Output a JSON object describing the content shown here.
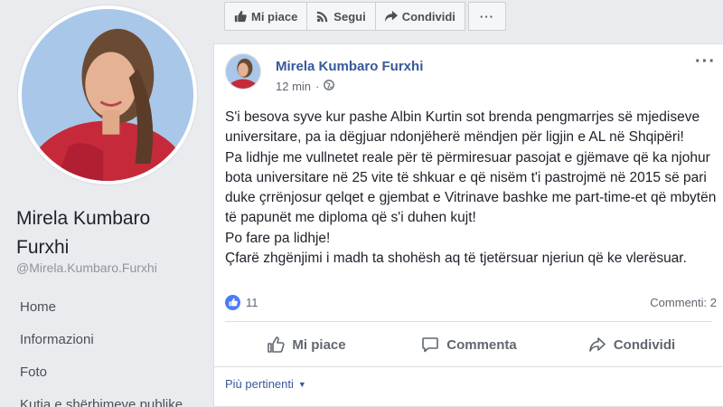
{
  "sidebar": {
    "name": "Mirela Kumbaro Furxhi",
    "handle": "@Mirela.Kumbaro.Furxhi",
    "nav": [
      {
        "label": "Home"
      },
      {
        "label": "Informazioni"
      },
      {
        "label": "Foto"
      },
      {
        "label": "Kutia e shërbimeve publike"
      }
    ]
  },
  "toolbar": {
    "like_label": "Mi piace",
    "follow_label": "Segui",
    "share_label": "Condividi",
    "more_label": "···"
  },
  "post": {
    "author": "Mirela Kumbaro Furxhi",
    "time": "12 min",
    "separator": "·",
    "options_label": "···",
    "lines": [
      "S'i besova syve kur pashe Albin Kurtin sot brenda pengmarrjes së mjediseve universitare, pa ia dëgjuar ndonjëherë mëndjen për ligjin e AL në Shqipëri!",
      "Pa lidhje me vullnetet reale për të përmiresuar pasojat e gjëmave që ka njohur bota universitare në 25 vite të shkuar e që nisëm t'i pastrojmë në 2015 së pari duke çrrënjosur qelqet e gjembat e Vitrinave bashke me part-time-et që mbytën të papunët me diploma që s'i duhen kujt!",
      "Po fare pa lidhje!",
      "Çfarë zhgënjimi i madh ta shohësh aq të tjetërsuar njeriun që ke vlerësuar."
    ],
    "likes_count": "11",
    "comments_label": "Commenti: 2",
    "actions": {
      "like": "Mi piace",
      "comment": "Commenta",
      "share": "Condividi"
    },
    "relevance_label": "Più pertinenti"
  },
  "colors": {
    "link_blue": "#385898",
    "like_blue": "#4a7cf6",
    "background": "#e9ebee"
  }
}
